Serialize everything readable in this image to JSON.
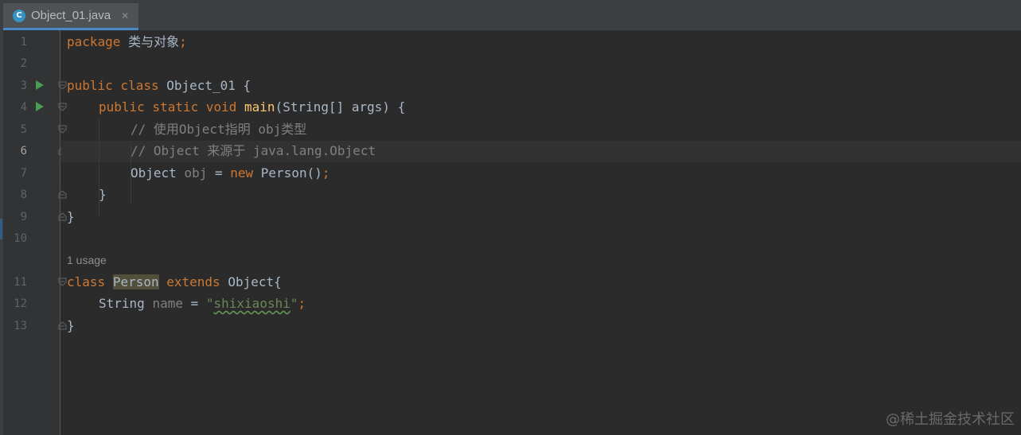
{
  "tab": {
    "icon": "java-class-icon",
    "icon_letter": "C",
    "filename": "Object_01.java",
    "close": "✕"
  },
  "line_numbers": [
    "1",
    "2",
    "3",
    "4",
    "5",
    "6",
    "7",
    "8",
    "9",
    "10",
    "11",
    "12",
    "13"
  ],
  "current_line": 6,
  "code": {
    "l1_kw": "package",
    "l1_rest": " 类与对象",
    "l1_semi": ";",
    "l3_kw": "public class",
    "l3_rest": " Object_01 {",
    "l4_kw1": "public static void",
    "l4_fn": "main",
    "l4_rest": "(String[] args) {",
    "l5_cm": "// 使用Object指明 obj类型",
    "l6_cm": "// Object 来源于 java.lang.Object",
    "l7_type": "Object",
    "l7_var": "obj",
    "l7_eq": " = ",
    "l7_new": "new",
    "l7_rest": " Person()",
    "l7_semi": ";",
    "l8": "}",
    "l9": "}",
    "usage": "1 usage",
    "l11_kw": "class",
    "l11_cls": "Person",
    "l11_kw2": "extends",
    "l11_rest": " Object{",
    "l12_type": "String",
    "l12_var": "name",
    "l12_eq": " = ",
    "l12_q1": "\"",
    "l12_str": "shixiaoshi",
    "l12_q2": "\"",
    "l12_semi": ";",
    "l13": "}"
  },
  "watermark": "@稀土掘金技术社区",
  "colors": {
    "background": "#2b2b2b",
    "keyword": "#cc7832",
    "string": "#6a8759",
    "comment": "#808080",
    "method": "#ffc66d",
    "text": "#a9b7c6"
  }
}
